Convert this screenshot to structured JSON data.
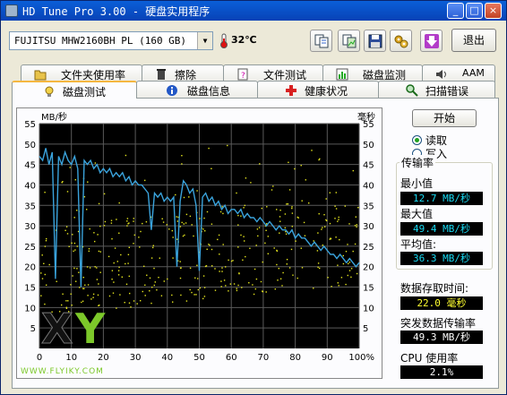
{
  "window": {
    "title": "HD Tune Pro 3.00 - 硬盘实用程序",
    "controls": [
      "_",
      "□",
      "×"
    ]
  },
  "toolbar": {
    "drive": "FUJITSU MHW2160BH PL (160 GB)",
    "temperature": "32℃",
    "exit_label": "退出",
    "icons": [
      "copy-text-icon",
      "copy-screenshot-icon",
      "save-icon",
      "options-icon",
      "download-icon"
    ]
  },
  "tabs_top": [
    {
      "label": "文件夹使用率",
      "icon": "folder-icon"
    },
    {
      "label": "擦除",
      "icon": "trash-icon"
    },
    {
      "label": "文件测试",
      "icon": "file-test-icon"
    },
    {
      "label": "磁盘监测",
      "icon": "monitor-icon"
    },
    {
      "label": "AAM",
      "icon": "speaker-icon"
    }
  ],
  "tabs_bottom": [
    {
      "label": "磁盘测试",
      "icon": "benchmark-icon",
      "active": true
    },
    {
      "label": "磁盘信息",
      "icon": "info-icon"
    },
    {
      "label": "健康状况",
      "icon": "health-icon"
    },
    {
      "label": "扫描错误",
      "icon": "scan-icon"
    }
  ],
  "controls": {
    "start_label": "开始",
    "read_label": "读取",
    "write_label": "写入",
    "selected": "读取"
  },
  "stats": {
    "transfer_rate_label": "传输率",
    "min_label": "最小值",
    "min_value": "12.7 MB/秒",
    "max_label": "最大值",
    "max_value": "49.4 MB/秒",
    "avg_label": "平均值:",
    "avg_value": "36.3 MB/秒",
    "access_time_label": "数据存取时间:",
    "access_time_value": "22.0 毫秒",
    "burst_label": "突发数据传输率",
    "burst_value": "49.3 MB/秒",
    "cpu_label": "CPU 使用率",
    "cpu_value": "2.1%"
  },
  "chart_data": {
    "type": "line",
    "ylabel_left": "MB/秒",
    "ylabel_right": "毫秒",
    "ylim": [
      0,
      55
    ],
    "xlim": [
      0,
      100
    ],
    "yticks": [
      5,
      10,
      15,
      20,
      25,
      30,
      35,
      40,
      45,
      50,
      55
    ],
    "xticks": [
      "0",
      "10",
      "20",
      "30",
      "40",
      "50",
      "60",
      "70",
      "80",
      "90",
      "100%"
    ],
    "grid": true,
    "series": [
      {
        "role": "transfer",
        "color": "#3aa3dc",
        "x": [
          0,
          1,
          2,
          3,
          4,
          5,
          6,
          7,
          8,
          9,
          10,
          11,
          12,
          13,
          14,
          15,
          16,
          17,
          18,
          19,
          20,
          21,
          22,
          23,
          24,
          25,
          26,
          27,
          28,
          29,
          30,
          31,
          32,
          33,
          34,
          35,
          36,
          37,
          38,
          39,
          40,
          41,
          42,
          43,
          44,
          45,
          46,
          47,
          48,
          49,
          50,
          51,
          52,
          53,
          54,
          55,
          56,
          57,
          58,
          59,
          60,
          61,
          62,
          63,
          64,
          65,
          66,
          67,
          68,
          69,
          70,
          71,
          72,
          73,
          74,
          75,
          76,
          77,
          78,
          79,
          80,
          81,
          82,
          83,
          84,
          85,
          86,
          87,
          88,
          89,
          90,
          91,
          92,
          93,
          94,
          95,
          96,
          97,
          98,
          99,
          100
        ],
        "y": [
          47,
          46,
          49,
          45,
          48,
          17,
          47,
          45,
          48,
          46,
          45,
          47,
          44,
          15,
          46,
          45,
          46,
          44,
          45,
          43,
          44,
          43,
          44,
          42,
          43,
          42,
          43,
          41,
          42,
          40,
          41,
          40,
          40,
          39,
          38,
          29,
          38,
          37,
          38,
          36,
          37,
          36,
          37,
          20,
          36,
          41,
          40,
          38,
          39,
          35,
          19,
          37,
          38,
          36,
          37,
          35,
          36,
          34,
          35,
          33,
          34,
          34,
          33,
          34,
          32,
          33,
          32,
          32,
          31,
          32,
          31,
          30,
          31,
          30,
          29,
          30,
          29,
          29,
          28,
          29,
          27,
          28,
          27,
          27,
          26,
          25,
          26,
          25,
          24,
          25,
          24,
          23,
          23,
          22,
          23,
          22,
          21,
          22,
          21,
          20,
          21
        ]
      },
      {
        "role": "access",
        "color": "#e6e61e",
        "note": "scatter of access times"
      }
    ]
  },
  "watermark": {
    "text": "WWW.FLYIKY.COM",
    "logo_text": "XY"
  }
}
